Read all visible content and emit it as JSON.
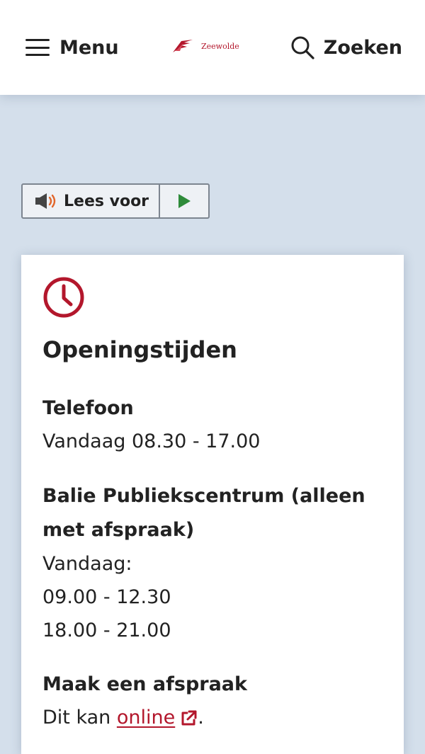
{
  "header": {
    "menu_label": "Menu",
    "logo_text": "Zeewolde",
    "search_label": "Zoeken"
  },
  "readspeaker": {
    "label": "Lees voor"
  },
  "openingstijden": {
    "title": "Openingstijden",
    "telefoon": {
      "title": "Telefoon",
      "hours": "Vandaag 08.30 - 17.00"
    },
    "balie": {
      "title_line1": "Balie Publiekscentrum (alleen",
      "title_line2": "met afspraak)",
      "day": "Vandaag:",
      "slot1": "09.00 - 12.30",
      "slot2": "18.00 - 21.00"
    },
    "afspraak": {
      "title": "Maak een afspraak",
      "text_before": "Dit kan",
      "link_text": "online",
      "text_after": "."
    }
  },
  "colors": {
    "accent": "#b3172c",
    "background": "#d4dfeb",
    "play_green": "#2e8b3a"
  },
  "icons": [
    "hamburger-icon",
    "zeewolde-logo",
    "search-icon",
    "speaker-icon",
    "play-icon",
    "clock-icon",
    "external-link-icon"
  ]
}
